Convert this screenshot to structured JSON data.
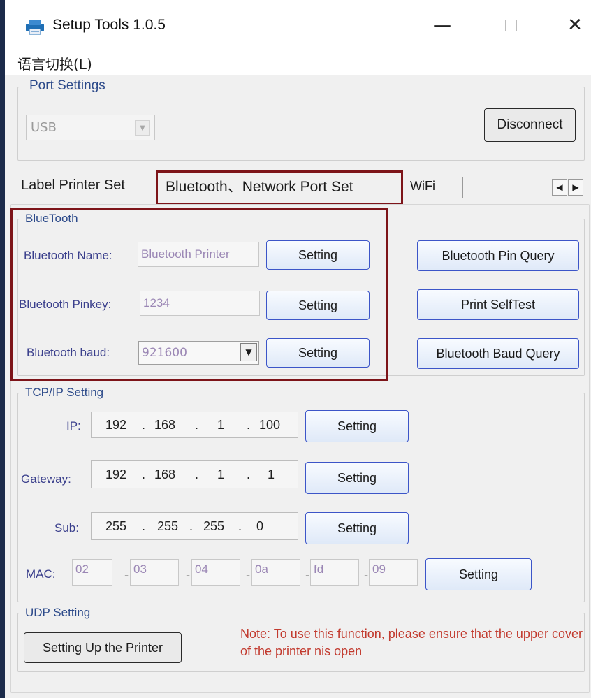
{
  "window": {
    "title": "Setup Tools 1.0.5",
    "min_glyph": "—",
    "close_glyph": "✕"
  },
  "menu": {
    "language": "语言切换(L)"
  },
  "port_settings": {
    "legend": "Port Settings",
    "port_value": "USB",
    "disconnect_label": "Disconnect"
  },
  "tabs": {
    "items": [
      {
        "label": "Label Printer Set"
      },
      {
        "label": "Bluetooth、Network Port Set"
      },
      {
        "label": "WiFi"
      }
    ],
    "scroll_left": "◀",
    "scroll_right": "▶"
  },
  "bluetooth": {
    "legend": "BlueTooth",
    "name_label": "Bluetooth Name:",
    "name_value": "Bluetooth Printer",
    "pinkey_label": "Bluetooth Pinkey:",
    "pinkey_value": "1234",
    "baud_label": "Bluetooth baud:",
    "baud_value": "921600",
    "setting_label": "Setting",
    "pin_query_label": "Bluetooth Pin Query",
    "self_test_label": "Print SelfTest",
    "baud_query_label": "Bluetooth Baud Query"
  },
  "tcpip": {
    "legend": "TCP/IP Setting",
    "ip_label": "IP:",
    "ip": [
      "192",
      "168",
      "1",
      "100"
    ],
    "gateway_label": "Gateway:",
    "gateway": [
      "192",
      "168",
      "1",
      "1"
    ],
    "sub_label": "Sub:",
    "sub": [
      "255",
      "255",
      "255",
      "0"
    ],
    "mac_label": "MAC:",
    "mac": [
      "02",
      "03",
      "04",
      "0a",
      "fd",
      "09"
    ],
    "setting_label": "Setting",
    "dot": ".",
    "dash": "-"
  },
  "udp": {
    "legend": "UDP Setting",
    "setup_label": "Setting Up the Printer",
    "note": "Note: To use this function, please ensure that the upper cover of the printer nis open"
  },
  "colors": {
    "accent_border": "#3c55c8",
    "highlight_frame": "#7d1419",
    "label_blue": "#3a3f8c",
    "note_red": "#c23a2e"
  },
  "icons": [
    "printer-icon",
    "minimize-icon",
    "maximize-icon",
    "close-icon",
    "chevron-down-icon",
    "arrow-left-icon",
    "arrow-right-icon"
  ]
}
